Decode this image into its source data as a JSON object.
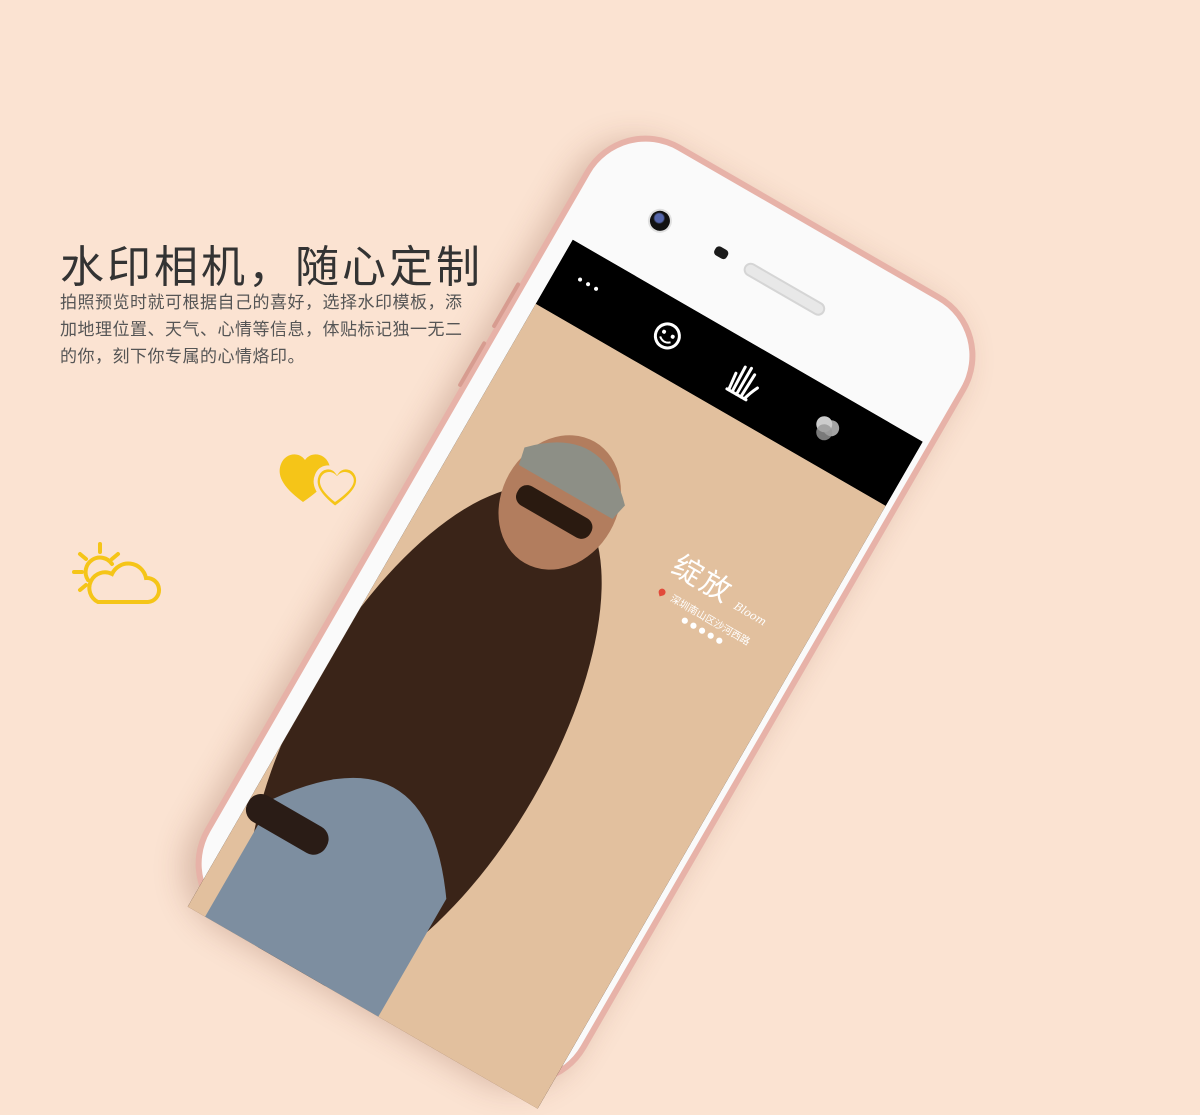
{
  "headline": "水印相机，随心定制",
  "description": {
    "line1": "拍照预览时就可根据自己的喜好，选择水印模板，添",
    "line2": "加地理位置、天气、心情等信息，体贴标记独一无二",
    "line3": "的你，刻下你专属的心情烙印。"
  },
  "colors": {
    "background": "#fbe3d2",
    "icon_yellow": "#f5c518",
    "phone_rose_gold": "#e7b2a8",
    "heading_text": "#333333",
    "body_text": "#555555"
  },
  "decor_icons": [
    "hearts-icon",
    "sun-cloud-icon",
    "location-pin-icon"
  ],
  "phone": {
    "toolbar_icons": [
      "more-dots-icon",
      "face-beauty-icon",
      "wave-hand-icon",
      "filter-circles-icon"
    ],
    "more_glyph": "•••",
    "watermark": {
      "title": "绽放",
      "subtitle": "Bloom",
      "location": "深圳南山区沙河西路",
      "dots": "●●●●●"
    }
  }
}
